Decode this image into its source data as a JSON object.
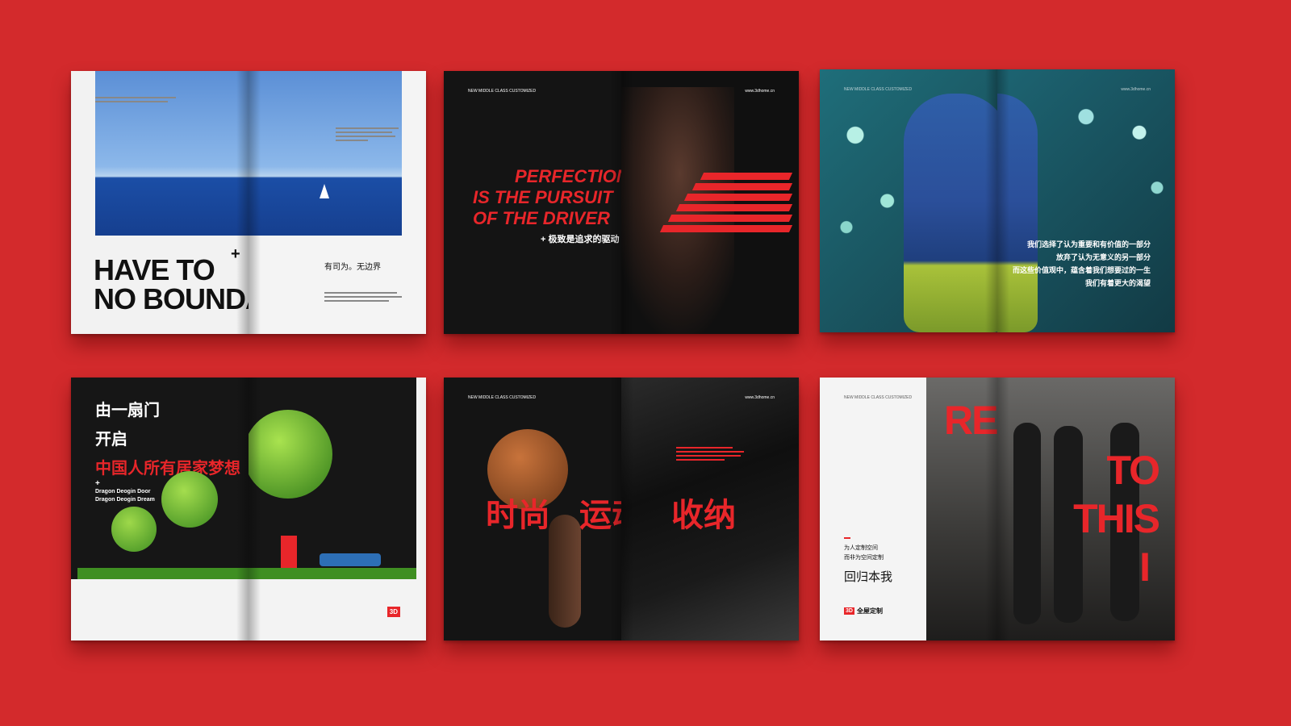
{
  "colors": {
    "background": "#d32a2c",
    "accent_red": "#e8262a",
    "dark_page": "#111111"
  },
  "magazines": [
    {
      "headline_line1": "HAVE TO",
      "plus": "+",
      "headline_line2": "NO BOUNDARY",
      "tagline": "有司为。无边界"
    },
    {
      "header_left": "NEW MIDDLE CLASS CUSTOMIZED",
      "header_right": "www.3dhome.cn",
      "headline_line1": "PERFECTION",
      "headline_line2": "IS THE PURSUIT",
      "headline_line3": "OF THE DRIVER",
      "subline": "+ 极致是追求的驱动"
    },
    {
      "header_left": "NEW MIDDLE CLASS CUSTOMIZED",
      "header_right": "www.3dhome.cn",
      "text_line1": "我们选择了认为重要和有价值的一部分",
      "text_line2": "放弃了认为无意义的另一部分",
      "text_line3": "而这些价值观中，蕴含着我们想要过的一生",
      "text_line4": "我们有着更大的渴望"
    },
    {
      "title_line1": "由一扇门",
      "title_line2": "开启",
      "title_line3": "中国人所有居家梦想",
      "plus": "+",
      "sub_line1": "Dragon Deogin Door",
      "sub_line2": "Dragon Deogin Dream",
      "logo": "3D"
    },
    {
      "header_left": "NEW MIDDLE CLASS CUSTOMIZED",
      "header_right": "www.3dhome.cn",
      "word1": "时尚",
      "word2": "运动",
      "word3": "收纳"
    },
    {
      "header_left": "NEW MIDDLE CLASS CUSTOMIZED",
      "small_line1": "为人定制空间",
      "small_line2": "而非为空间定制",
      "title": "回归本我",
      "logo_mark": "3D",
      "logo_text": "全屋定制",
      "headline_line1": "RETURN",
      "headline_line2": "TO",
      "headline_line3": "THIS",
      "headline_line4": "I"
    }
  ]
}
